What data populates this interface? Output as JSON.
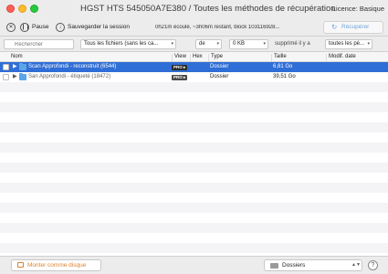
{
  "window": {
    "title": "HGST HTS 545050A7E380 / Toutes les méthodes de récupération",
    "licence": "Licence: Basique"
  },
  "toolbar": {
    "pause_label": "Pause",
    "save_session_label": "Sauvegarder la session",
    "status_text": "0h21m écoulé, ~3h06m restant, block 103116928...",
    "recover_label": "Récupérer"
  },
  "filters": {
    "search_placeholder": "Rechercher",
    "file_type": "Tous les fichiers (sans les ca...",
    "size_op": "de",
    "size_value": "0 KB",
    "deleted_label": "supprimé il y a",
    "time_range": "toutes les pé..."
  },
  "table": {
    "columns": [
      "Nom",
      "View",
      "Hex",
      "Type",
      "Taille",
      "Modif. date"
    ],
    "rows": [
      {
        "name": "Scan Approfondi - reconstruit (6544)",
        "view": "PRO",
        "type": "Dossier",
        "size": "6,81 Go",
        "modified": "",
        "selected": true
      },
      {
        "name": "San Approfondi - étiqueté (18472)",
        "view": "PRO",
        "type": "Dossier",
        "size": "39,51 Go",
        "modified": "",
        "selected": false
      }
    ]
  },
  "bottom": {
    "mount_label": "Monter comme disque",
    "view_mode": "Dossiers",
    "help_label": "?"
  },
  "colors": {
    "selection": "#2f6ed6",
    "recover_text": "#6fa3da",
    "mount_text": "#e0802f",
    "folder": "#5aa5e8"
  }
}
